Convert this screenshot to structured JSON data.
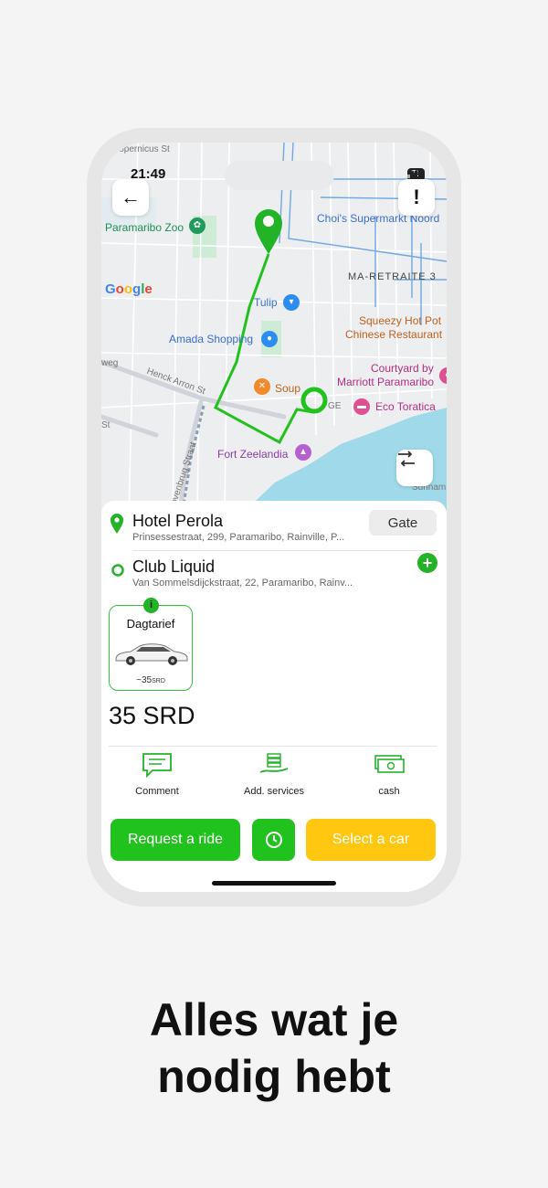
{
  "status_bar": {
    "time": "21:49",
    "battery": "79"
  },
  "map": {
    "labels": {
      "street_top": "Copernicus St",
      "zoo": "Paramaribo Zoo",
      "supermarket": "Choi's Supermarkt Noord",
      "district": "MA-RETRAITE 3",
      "tulip": "Tulip",
      "amada": "Amada Shopping",
      "squeezy_line1": "Squeezy Hot Pot",
      "squeezy_line2": "Chinese Restaurant",
      "courtyard_line1": "Courtyard by",
      "courtyard_line2": "Marriott Paramaribo",
      "soup": "Soup",
      "eco": "Eco Toratica",
      "fort": "Fort Zeelandia",
      "henck": "Henck Arron St",
      "hovenbrug": "Hovenbrug Straat",
      "weg": "weg",
      "st": "St",
      "ge": "GE",
      "surinam": "Surinam",
      "google": "Google"
    },
    "colors": {
      "route": "#22c21e",
      "water": "#9fd9ea"
    }
  },
  "route": {
    "pickup": {
      "name": "Hotel Perola",
      "address": "Prinsessestraat, 299, Paramaribo, Rainville, P...",
      "gate_label": "Gate"
    },
    "destination": {
      "name": "Club Liquid",
      "address": "Van Sommelsdijckstraat, 22, Paramaribo, Rainv..."
    }
  },
  "tariff": {
    "name": "Dagtarief",
    "price": "~35",
    "currency": "SRD",
    "info": "i"
  },
  "price_display": "35 SRD",
  "options": [
    {
      "label": "Comment",
      "icon": "comment-icon"
    },
    {
      "label": "Add. services",
      "icon": "services-icon"
    },
    {
      "label": "cash",
      "icon": "cash-icon"
    }
  ],
  "buttons": {
    "request": "Request a ride",
    "schedule_icon": "clock-icon",
    "select_car": "Select a car"
  },
  "tagline": {
    "line1": "Alles wat je",
    "line2": "nodig hebt"
  },
  "accent": {
    "green": "#22c21e",
    "yellow": "#ffc710"
  }
}
